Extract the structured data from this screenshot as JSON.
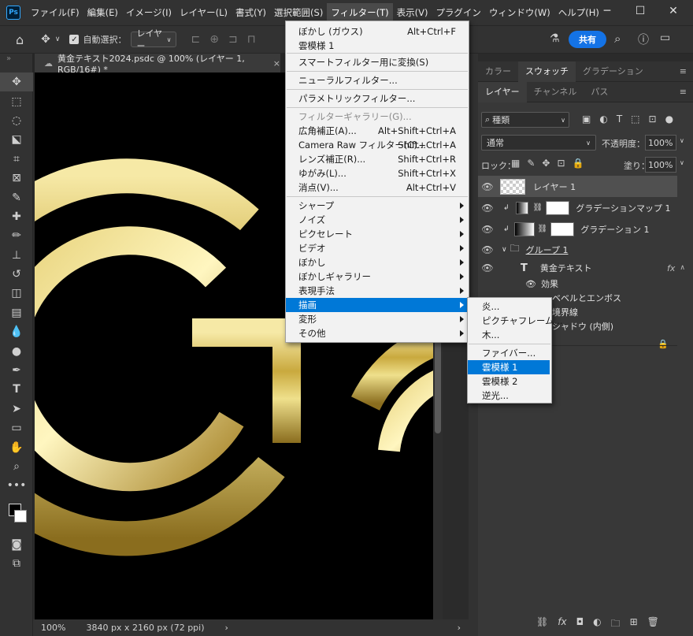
{
  "menubar": {
    "logo": "Ps",
    "items": [
      "ファイル(F)",
      "編集(E)",
      "イメージ(I)",
      "レイヤー(L)",
      "書式(Y)",
      "選択範囲(S)",
      "フィルター(T)",
      "表示(V)",
      "プラグイン",
      "ウィンドウ(W)",
      "ヘルプ(H)"
    ]
  },
  "optionsbar": {
    "auto_select_label": "自動選択：",
    "auto_select_value": "レイヤー",
    "share_label": "共有"
  },
  "document": {
    "tab_title": "黄金テキスト2024.psdc @ 100% (レイヤー 1, RGB/16#) *",
    "close": "×",
    "zoom": "100%",
    "dimensions": "3840 px x 2160 px (72 ppi)",
    "canvas_text": "GO"
  },
  "panels": {
    "top_tabs": [
      "カラー",
      "スウォッチ",
      "グラデーション"
    ],
    "layer_tabs": [
      "レイヤー",
      "チャンネル",
      "パス"
    ],
    "filter_kind": "種類",
    "blend_mode": "通常",
    "opacity_label": "不透明度：",
    "opacity_value": "100%",
    "lock_label": "ロック：",
    "fill_label": "塗り：",
    "fill_value": "100%"
  },
  "layers": [
    {
      "name": "レイヤー 1",
      "kind": "pixel",
      "selected": true
    },
    {
      "name": "グラデーションマップ 1",
      "kind": "adjust"
    },
    {
      "name": "グラデーション 1",
      "kind": "gradient"
    },
    {
      "name": "グループ 1",
      "kind": "group"
    },
    {
      "name": "黄金テキスト",
      "kind": "text",
      "fx": "fx"
    },
    {
      "name": "効果",
      "kind": "effects"
    },
    {
      "name": "ベベルとエンボス",
      "kind": "effect"
    },
    {
      "name": "境界線",
      "kind": "effect"
    },
    {
      "name": "シャドウ (内側)",
      "kind": "effect"
    }
  ],
  "filter_menu": {
    "items": [
      {
        "label": "ぼかし (ガウス)",
        "shortcut": "Alt+Ctrl+F"
      },
      {
        "label": "雲模様 1",
        "shortcut": ""
      },
      {
        "label": "スマートフィルター用に変換(S)",
        "shortcut": ""
      },
      {
        "label": "ニューラルフィルター...",
        "shortcut": ""
      },
      {
        "label": "パラメトリックフィルター...",
        "shortcut": ""
      },
      {
        "label": "フィルターギャラリー(G)...",
        "shortcut": "",
        "disabled": true
      },
      {
        "label": "広角補正(A)...",
        "shortcut": "Alt+Shift+Ctrl+A"
      },
      {
        "label": "Camera Raw フィルター(C)...",
        "shortcut": "Shift+Ctrl+A"
      },
      {
        "label": "レンズ補正(R)...",
        "shortcut": "Shift+Ctrl+R"
      },
      {
        "label": "ゆがみ(L)...",
        "shortcut": "Shift+Ctrl+X"
      },
      {
        "label": "消点(V)...",
        "shortcut": "Alt+Ctrl+V"
      },
      {
        "label": "シャープ",
        "submenu": true
      },
      {
        "label": "ノイズ",
        "submenu": true
      },
      {
        "label": "ピクセレート",
        "submenu": true
      },
      {
        "label": "ビデオ",
        "submenu": true
      },
      {
        "label": "ぼかし",
        "submenu": true
      },
      {
        "label": "ぼかしギャラリー",
        "submenu": true
      },
      {
        "label": "表現手法",
        "submenu": true
      },
      {
        "label": "描画",
        "submenu": true,
        "highlighted": true
      },
      {
        "label": "変形",
        "submenu": true
      },
      {
        "label": "その他",
        "submenu": true
      }
    ]
  },
  "render_submenu": {
    "items": [
      "炎...",
      "ピクチャフレーム...",
      "木...",
      "ファイバー...",
      "雲模様 1",
      "雲模様 2",
      "逆光..."
    ],
    "highlighted": "雲模様 1"
  },
  "colors": {
    "accent": "#0078d7",
    "share": "#1473e6",
    "gold": "#d8bd5a"
  }
}
